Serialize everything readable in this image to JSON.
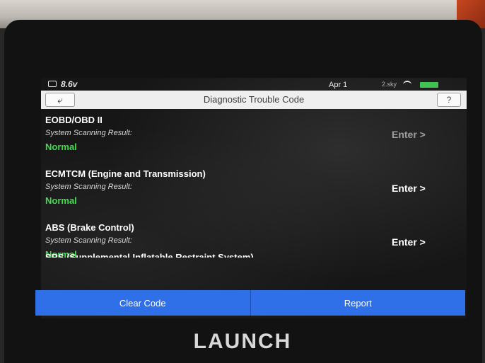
{
  "status_bar": {
    "voltage": "8.6v",
    "date": "Apr 1",
    "signal": "2.sky",
    "icons": [
      "battery-small-icon",
      "wifi-icon",
      "battery-icon"
    ],
    "battery_color": "#39c24a"
  },
  "header": {
    "back_icon": "back-arrow-icon",
    "back_symbol": "⤶",
    "title": "Diagnostic Trouble Code",
    "help_icon": "help-icon",
    "help_symbol": "?"
  },
  "results": [
    {
      "system": "EOBD/OBD II",
      "scan_label": "System Scanning Result:",
      "status": "Normal",
      "action": "Enter >"
    },
    {
      "system": "ECMTCM (Engine and Transmission)",
      "scan_label": "System Scanning Result:",
      "status": "Normal",
      "action": "Enter >"
    },
    {
      "system": "ABS (Brake Control)",
      "scan_label": "System Scanning Result:",
      "status": "Normal",
      "action": "Enter >"
    }
  ],
  "partial_item": "SRS (Supplemental Inflatable Restraint System)",
  "buttons": {
    "clear_code": "Clear Code",
    "report": "Report"
  },
  "device": {
    "brand": "LAUNCH"
  },
  "colors": {
    "accent": "#2f6fe8",
    "status_normal": "#3ddc4a",
    "title_bar": "#eeeeee",
    "screen_bg": "#161616"
  }
}
